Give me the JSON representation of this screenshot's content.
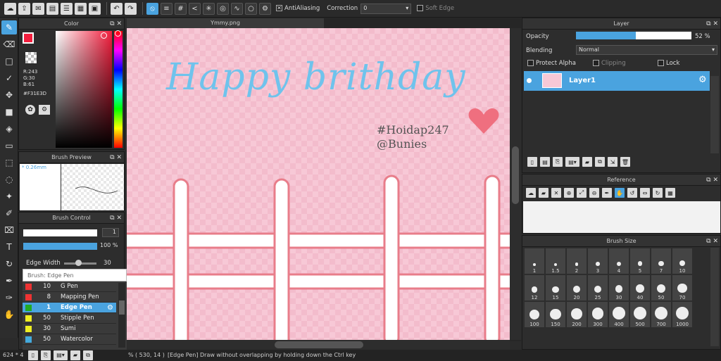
{
  "toolbar": {
    "antialiasing_label": "AntiAliasing",
    "correction_label": "Correction",
    "correction_value": "0",
    "soft_edge_label": "Soft Edge"
  },
  "color_panel": {
    "title": "Color",
    "r": "R:243",
    "g": "G:30",
    "b": "B:61",
    "hex": "#F31E3D",
    "fg_color": "#F31E3D"
  },
  "brush_preview": {
    "title": "Brush Preview",
    "size": "0.26mm"
  },
  "brush_control": {
    "title": "Brush Control",
    "size_value": "1",
    "opacity_value": "100 %",
    "edge_width_label": "Edge Width",
    "edge_width_value": "30",
    "brush_label": "Brush: Edge Pen",
    "brushes": [
      {
        "num": "10",
        "name": "G Pen",
        "color": "#e33"
      },
      {
        "num": "8",
        "name": "Mapping Pen",
        "color": "#e33"
      },
      {
        "num": "1",
        "name": "Edge Pen",
        "color": "#2a2"
      },
      {
        "num": "50",
        "name": "Stipple Pen",
        "color": "#ee2"
      },
      {
        "num": "30",
        "name": "Sumi",
        "color": "#ee2"
      },
      {
        "num": "50",
        "name": "Watercolor",
        "color": "#4ad"
      }
    ]
  },
  "document": {
    "tab_title": "Ymmy.png",
    "headline": "Happy brithday",
    "tag1": "#Hoidap247",
    "tag2": "@Bunies"
  },
  "layer_panel": {
    "title": "Layer",
    "opacity_label": "Opacity",
    "opacity_value": "52 %",
    "opacity": 0.52,
    "blending_label": "Blending",
    "blending_value": "Normal",
    "protect_alpha_label": "Protect Alpha",
    "clipping_label": "Clipping",
    "lock_label": "Lock",
    "layer_name": "Layer1"
  },
  "reference_panel": {
    "title": "Reference"
  },
  "brush_size_panel": {
    "title": "Brush Size",
    "sizes": [
      "1",
      "1.5",
      "2",
      "3",
      "4",
      "5",
      "7",
      "10",
      "12",
      "15",
      "20",
      "25",
      "30",
      "40",
      "50",
      "70",
      "100",
      "150",
      "200",
      "300",
      "400",
      "500",
      "700",
      "1000"
    ]
  },
  "status": {
    "canvas_size": "624 * 4",
    "zoom_suffix": "%",
    "coords": "( 530, 14 )",
    "message": "[Edge Pen] Draw without overlapping by holding down the Ctrl key"
  }
}
